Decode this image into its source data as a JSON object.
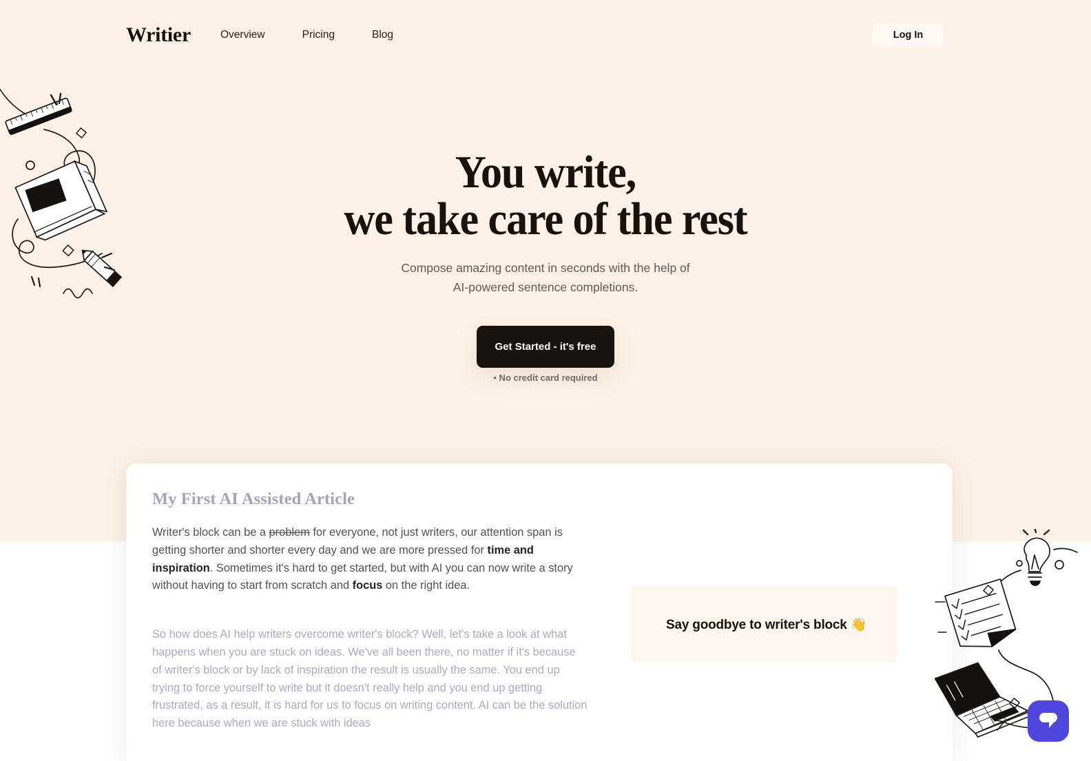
{
  "nav": {
    "logo": "Writier",
    "links": [
      {
        "label": "Overview"
      },
      {
        "label": "Pricing"
      },
      {
        "label": "Blog"
      }
    ],
    "login_label": "Log In"
  },
  "hero": {
    "title_line1": "You write,",
    "title_line2": "we take care of the rest",
    "sub_line1": "Compose amazing content in seconds with the help of",
    "sub_line2": "AI-powered sentence completions.",
    "cta_label": "Get Started - it's free",
    "cta_note": "• No credit card required"
  },
  "editor": {
    "doc_title": "My First AI Assisted Article",
    "paragraph_1": {
      "seg_1": "Writer's block can be a ",
      "strike": "problem",
      "seg_2": " for everyone, not just writers, our attention span is getting shorter and shorter every day and we are more pressed for ",
      "bold_1": "time and inspiration",
      "seg_3": ". Sometimes it's hard to get started, but with AI you can now write a story without having to start from scratch and ",
      "bold_2": "focus",
      "seg_4": " on the right idea."
    },
    "paragraph_suggestion": "So how does AI help writers overcome writer's block? Well, let's take a look at what happens when you are stuck on ideas. We've all been there, no matter if it's because of writer's block or by lack of inspiration the result is usually the same. You end up trying to force yourself to write but it doesn't really help and you end up getting frustrated, as a result, it is hard for us to focus on writing content. AI can be the solution here because when we are stuck with ideas",
    "callout_text": "Say goodbye to writer's block 👋"
  },
  "colors": {
    "hero_background": "#fdf1e7",
    "page_background": "#ffffff",
    "cta_background": "#17130f",
    "doc_title": "#a3a3bd",
    "suggestion_text": "#a9a9c4",
    "callout_background": "#fdf6ef",
    "chat_button": "#4e46dd"
  },
  "icons": {
    "chat": "chat-bubble-icon",
    "left_doodle": "stationery-doodle-illustration",
    "right_doodle": "idea-laptop-doodle-illustration"
  }
}
